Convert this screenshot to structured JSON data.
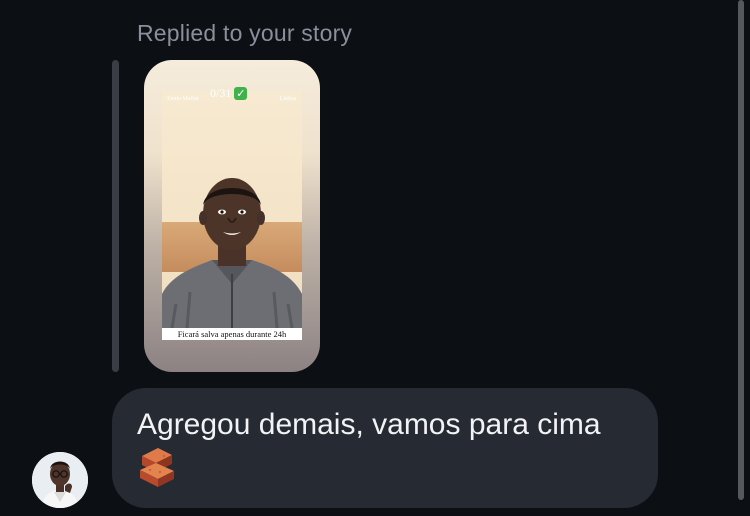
{
  "reply": {
    "header": "Replied to your story"
  },
  "story": {
    "tag_left": "Zénio Mallin",
    "tag_right": "Lisboa",
    "counter": "0/31",
    "caption": "Ficará salva apenas durante 24h"
  },
  "message": {
    "text": "Agregou demais, vamos para cima",
    "emoji_icon": "brick-icon"
  },
  "colors": {
    "background": "#0c0f14",
    "bubble": "#262a33",
    "reply_header": "#8a8f99",
    "message_text": "#f2f3f5"
  }
}
